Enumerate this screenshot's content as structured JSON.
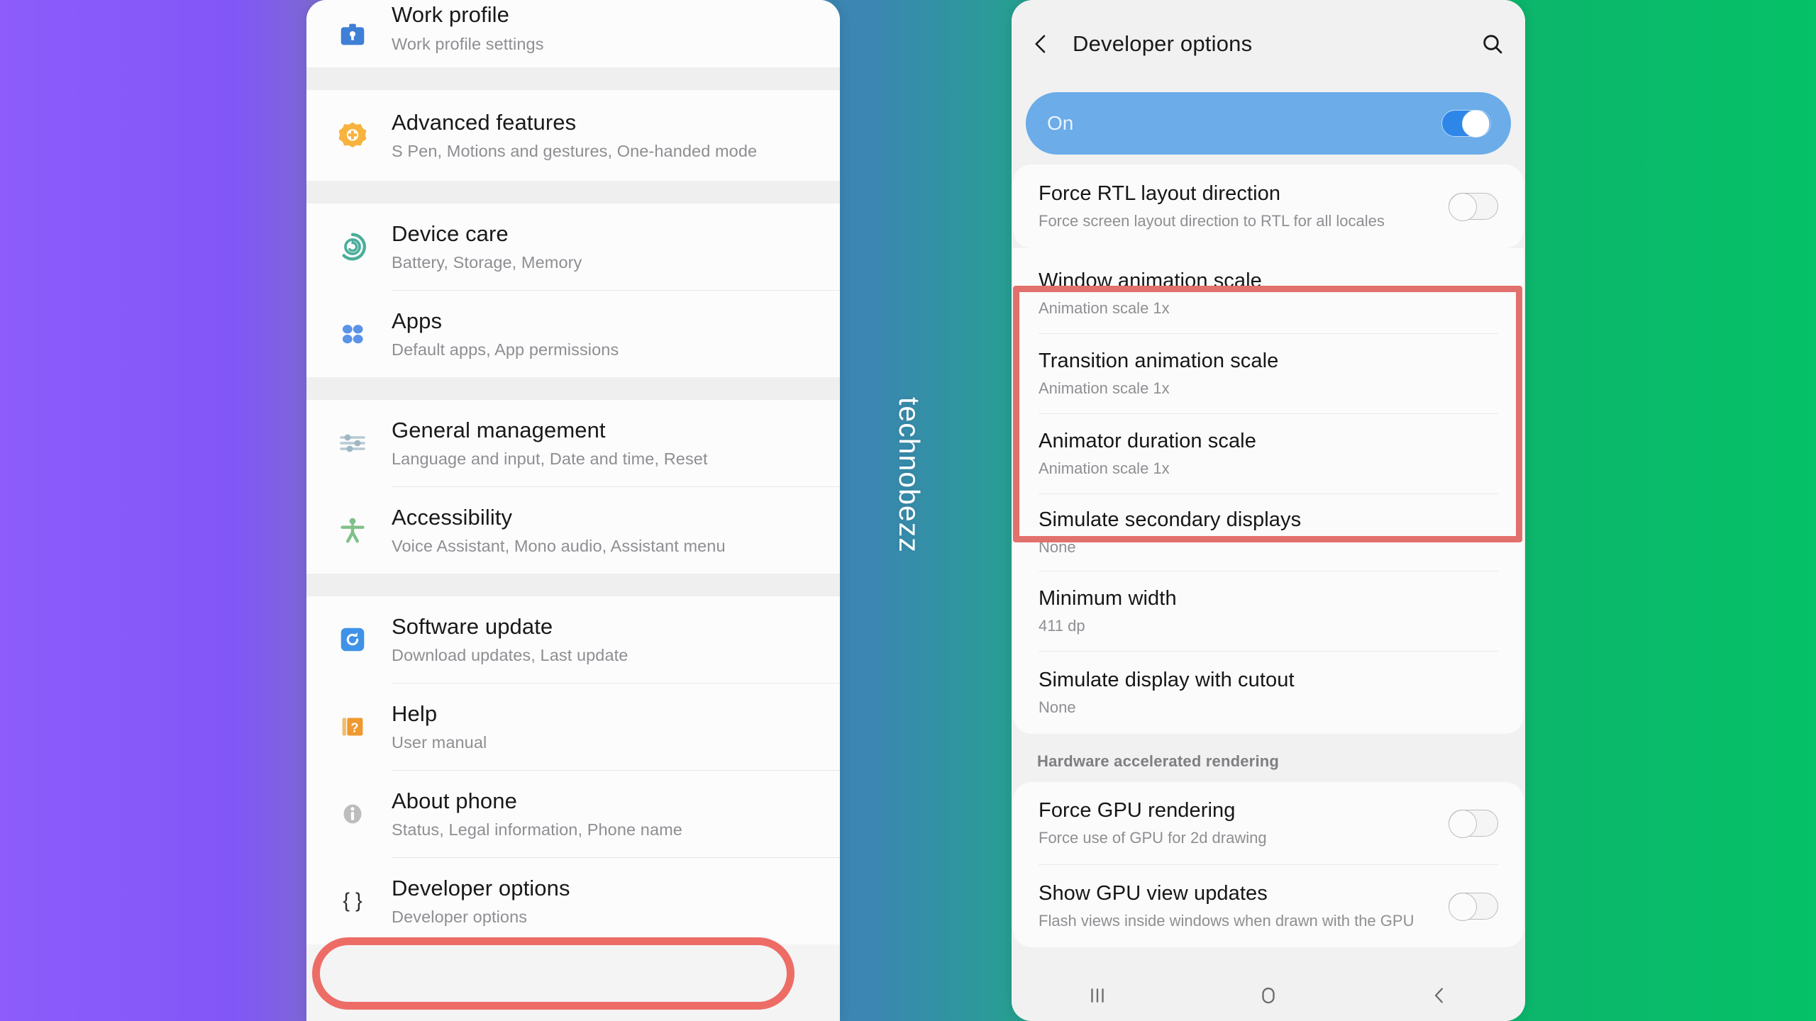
{
  "watermark": {
    "text": "technobezz"
  },
  "colors": {
    "bg_left": "#8d5cfb",
    "bg_mid": "#3b86b2",
    "bg_right": "#05c167",
    "highlight_red": "#e2706c",
    "pill_red": "#ed6d66",
    "master_blue": "#6bace9"
  },
  "left_phone": {
    "groups": [
      {
        "items": [
          {
            "icon": "work-profile-icon",
            "title": "Work profile",
            "subtitle": "Work profile settings",
            "clipped": true
          }
        ]
      },
      {
        "items": [
          {
            "icon": "advanced-features-icon",
            "title": "Advanced features",
            "subtitle": "S Pen, Motions and gestures, One-handed mode"
          }
        ]
      },
      {
        "items": [
          {
            "icon": "device-care-icon",
            "title": "Device care",
            "subtitle": "Battery, Storage, Memory"
          },
          {
            "icon": "apps-icon",
            "title": "Apps",
            "subtitle": "Default apps, App permissions"
          }
        ]
      },
      {
        "items": [
          {
            "icon": "general-management-icon",
            "title": "General management",
            "subtitle": "Language and input, Date and time, Reset"
          },
          {
            "icon": "accessibility-icon",
            "title": "Accessibility",
            "subtitle": "Voice Assistant, Mono audio, Assistant menu"
          }
        ]
      },
      {
        "items": [
          {
            "icon": "software-update-icon",
            "title": "Software update",
            "subtitle": "Download updates, Last update"
          },
          {
            "icon": "help-icon",
            "title": "Help",
            "subtitle": "User manual"
          },
          {
            "icon": "about-phone-icon",
            "title": "About phone",
            "subtitle": "Status, Legal information, Phone name"
          },
          {
            "icon": "developer-options-icon",
            "title": "Developer options",
            "subtitle": "Developer options",
            "highlighted": true
          }
        ]
      }
    ]
  },
  "right_phone": {
    "appbar": {
      "back_icon": "chevron-left-icon",
      "title": "Developer options",
      "search_icon": "search-icon"
    },
    "master_switch": {
      "label": "On",
      "state": "on"
    },
    "groups": [
      {
        "rows": [
          {
            "title": "Force RTL layout direction",
            "subtitle": "Force screen layout direction to RTL for all locales",
            "toggle": "off"
          }
        ]
      },
      {
        "highlighted": true,
        "rows": [
          {
            "title": "Window animation scale",
            "subtitle": "Animation scale 1x"
          },
          {
            "title": "Transition animation scale",
            "subtitle": "Animation scale 1x"
          },
          {
            "title": "Animator duration scale",
            "subtitle": "Animation scale 1x"
          }
        ]
      },
      {
        "rows": [
          {
            "title": "Simulate secondary displays",
            "subtitle": "None"
          },
          {
            "title": "Minimum width",
            "subtitle": "411 dp"
          },
          {
            "title": "Simulate display with cutout",
            "subtitle": "None"
          }
        ]
      }
    ],
    "section_header": "Hardware accelerated rendering",
    "gpu_rows": [
      {
        "title": "Force GPU rendering",
        "subtitle": "Force use of GPU for 2d drawing",
        "toggle": "off"
      },
      {
        "title": "Show GPU view updates",
        "subtitle": "Flash views inside windows when drawn with the GPU",
        "toggle": "off"
      }
    ],
    "navbar": {
      "recents_icon": "recents-icon",
      "home_icon": "home-icon",
      "back_icon": "back-icon"
    }
  }
}
